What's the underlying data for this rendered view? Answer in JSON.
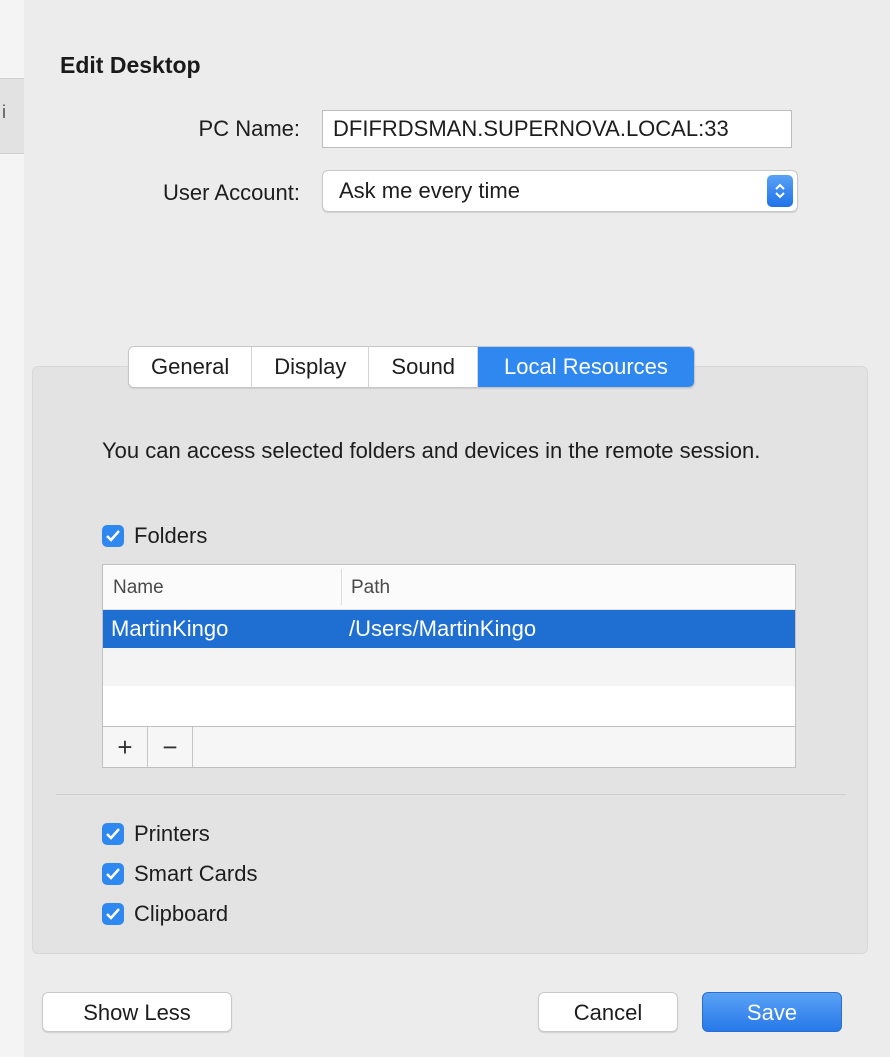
{
  "dialog": {
    "title": "Edit Desktop",
    "pc_name_label": "PC Name:",
    "pc_name_value": "DFIFRDSMAN.SUPERNOVA.LOCAL:33",
    "user_account_label": "User Account:",
    "user_account_value": "Ask me every time"
  },
  "tabs": [
    {
      "label": "General",
      "active": false
    },
    {
      "label": "Display",
      "active": false
    },
    {
      "label": "Sound",
      "active": false
    },
    {
      "label": "Local Resources",
      "active": true
    }
  ],
  "local_resources": {
    "description": "You can access selected folders and devices in the remote session.",
    "folders_label": "Folders",
    "folders_checked": true,
    "table": {
      "columns": [
        "Name",
        "Path"
      ],
      "rows": [
        {
          "name": "MartinKingo",
          "path": "/Users/MartinKingo",
          "selected": true
        }
      ],
      "add_label": "+",
      "remove_label": "−"
    },
    "devices": [
      {
        "label": "Printers",
        "checked": true
      },
      {
        "label": "Smart Cards",
        "checked": true
      },
      {
        "label": "Clipboard",
        "checked": true
      }
    ]
  },
  "buttons": {
    "show_less": "Show Less",
    "cancel": "Cancel",
    "save": "Save"
  },
  "colors": {
    "accent": "#2f87f0",
    "selection": "#1f6fd2"
  },
  "background_window": {
    "fragment_text": "i"
  }
}
